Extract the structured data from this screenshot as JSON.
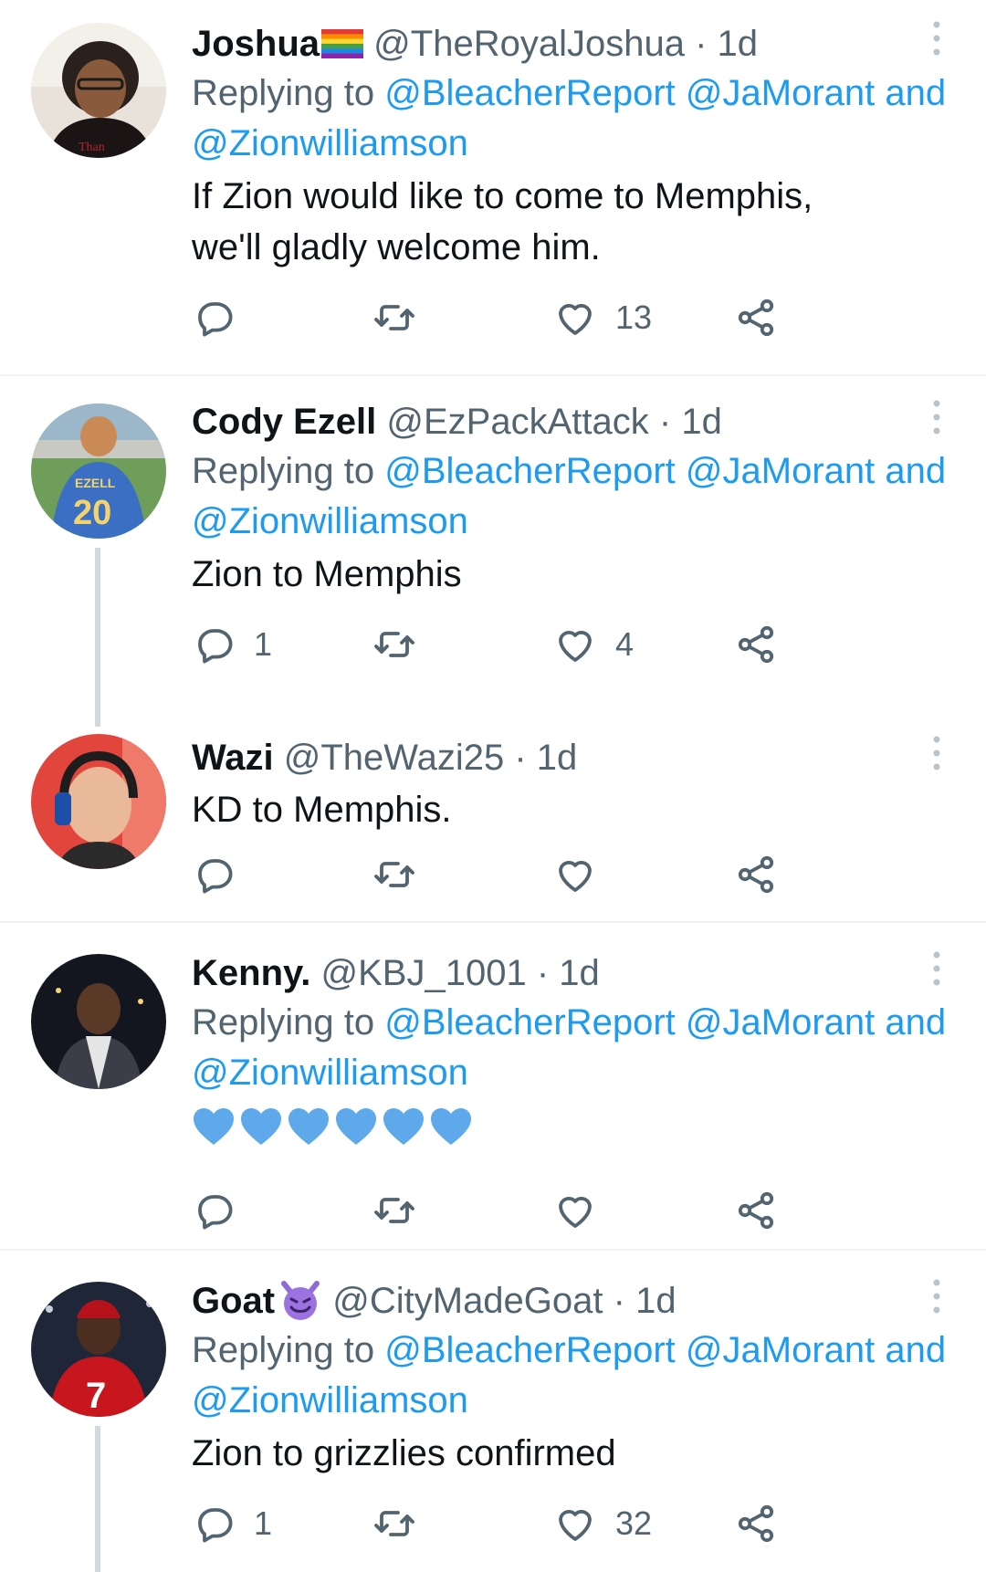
{
  "replying_to_label": "Replying to",
  "tweets": [
    {
      "name": "Joshua",
      "name_emoji": "rainbow-flag-icon",
      "handle": "@TheRoyalJoshua",
      "time": "· 1d",
      "mentions_line1": "@BleacherReport @JaMorant and",
      "mentions_line2": "@Zionwilliamson",
      "text": "If Zion would like to come to Memphis, we'll gladly welcome him.",
      "reply_count": "",
      "retweet_count": "",
      "like_count": "13"
    },
    {
      "name": "Cody Ezell",
      "handle": "@EzPackAttack",
      "time": "· 1d",
      "mentions_line1": "@BleacherReport @JaMorant and",
      "mentions_line2": "@Zionwilliamson",
      "text": "Zion to Memphis",
      "reply_count": "1",
      "retweet_count": "",
      "like_count": "4"
    },
    {
      "name": "Wazi",
      "handle": "@TheWazi25",
      "time": "· 1d",
      "text": "KD to Memphis.",
      "reply_count": "",
      "retweet_count": "",
      "like_count": ""
    },
    {
      "name": "Kenny.",
      "handle": "@KBJ_1001",
      "time": "· 1d",
      "mentions_line1": "@BleacherReport @JaMorant and",
      "mentions_line2": "@Zionwilliamson",
      "text_emoji": "blue-heart-icon x6",
      "reply_count": "",
      "retweet_count": "",
      "like_count": ""
    },
    {
      "name": "Goat",
      "name_emoji": "smiling-devil-icon",
      "handle": "@CityMadeGoat",
      "time": "· 1d",
      "mentions_line1": "@BleacherReport @JaMorant and",
      "mentions_line2": "@Zionwilliamson",
      "text": "Zion to grizzlies confirmed",
      "reply_count": "1",
      "retweet_count": "",
      "like_count": "32"
    }
  ],
  "colors": {
    "link": "#1d9bf0",
    "secondary_text": "#536471",
    "divider": "#eff3f4",
    "thread_line": "#cfd9de",
    "heart_emoji": "#5da9e9"
  }
}
